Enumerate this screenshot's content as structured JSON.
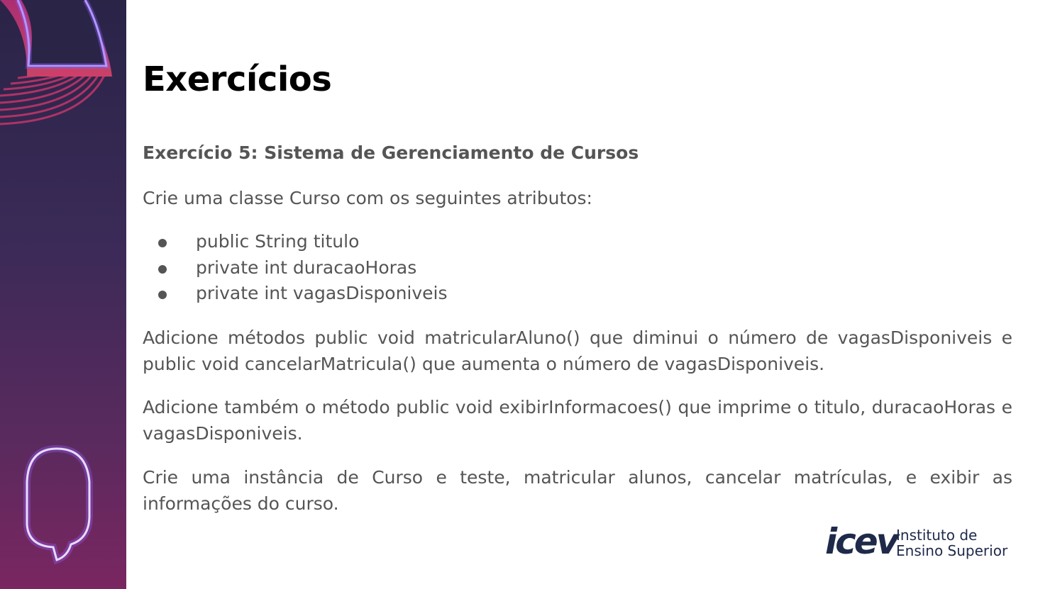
{
  "slide": {
    "title": "Exercícios",
    "subtitle": "Exercício 5: Sistema de Gerenciamento de Cursos",
    "intro": "Crie uma classe Curso com os seguintes atributos:",
    "bullets": [
      "public String titulo",
      "private int duracaoHoras",
      "private int vagasDisponiveis"
    ],
    "paragraph_methods": "Adicione métodos public void matricularAluno() que diminui o número de vagasDisponiveis e public void cancelarMatricula() que aumenta o número de vagasDisponiveis.",
    "paragraph_display": "Adicione também o método public void exibirInformacoes() que imprime o titulo, duracaoHoras e vagasDisponiveis.",
    "paragraph_test": "Crie uma instância de Curso e teste, matricular alunos, cancelar matrículas, e exibir as informações do curso."
  },
  "logo": {
    "mark": "icev",
    "line1": "Instituto de",
    "line2": "Ensino Superior"
  },
  "colors": {
    "accent_pink": "#e0337a",
    "accent_purple": "#9b5cff",
    "text": "#555555",
    "logo": "#1f2a4a"
  }
}
